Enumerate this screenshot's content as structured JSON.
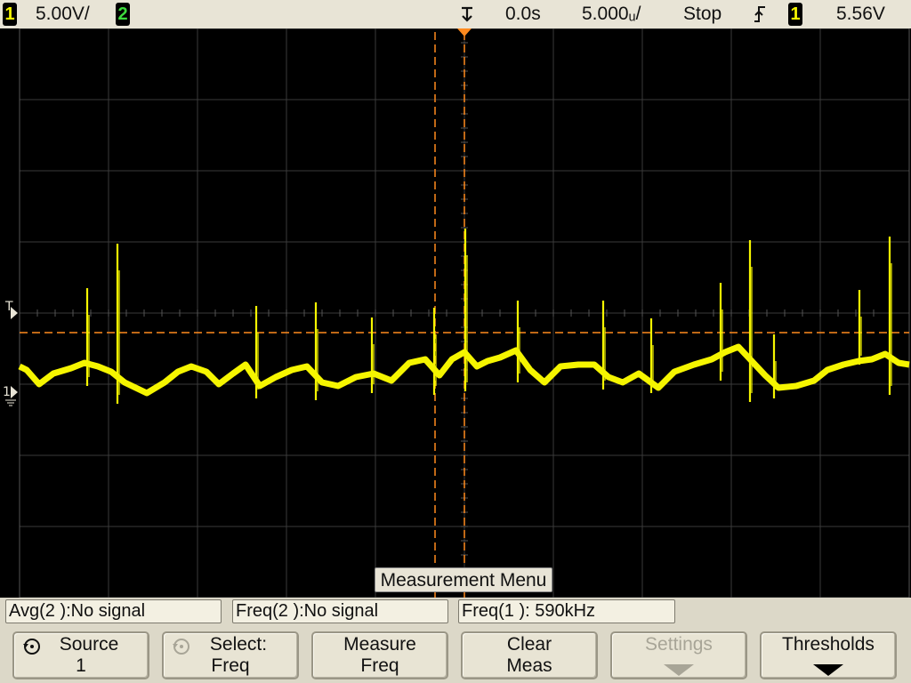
{
  "status": {
    "ch1_number": "1",
    "ch1_scale": "5.00V/",
    "ch2_number": "2",
    "time_offset": "0.0s",
    "time_scale": "5.000ᵤ/",
    "run_state": "Stop",
    "trigger_slope_icon": "rising-edge-icon",
    "trigger_source": "1",
    "trigger_level": "5.56V"
  },
  "screen": {
    "trigger_marker_label": "T",
    "ch1_ground_label": "1",
    "colors": {
      "ch1": "#f5f500",
      "cursor": "#ff8a1e",
      "grid": "#3a3a3a"
    }
  },
  "menu": {
    "title": "Measurement Menu",
    "measurements": [
      "Avg(2 ):No signal",
      "Freq(2 ):No signal",
      "Freq(1 ): 590kHz"
    ],
    "softkeys": [
      {
        "line1": "Source",
        "line2": "1",
        "icon": "rotate-knob-icon",
        "enabled": true
      },
      {
        "line1": "Select:",
        "line2": "Freq",
        "icon": "rotate-knob-icon",
        "enabled": true
      },
      {
        "line1": "Measure",
        "line2": "Freq",
        "enabled": true
      },
      {
        "line1": "Clear",
        "line2": "Meas",
        "enabled": true
      },
      {
        "line1": "Settings",
        "line2": "",
        "icon": "down-arrow-icon",
        "enabled": false
      },
      {
        "line1": "Thresholds",
        "line2": "",
        "icon": "down-arrow-icon",
        "enabled": true
      }
    ]
  }
}
